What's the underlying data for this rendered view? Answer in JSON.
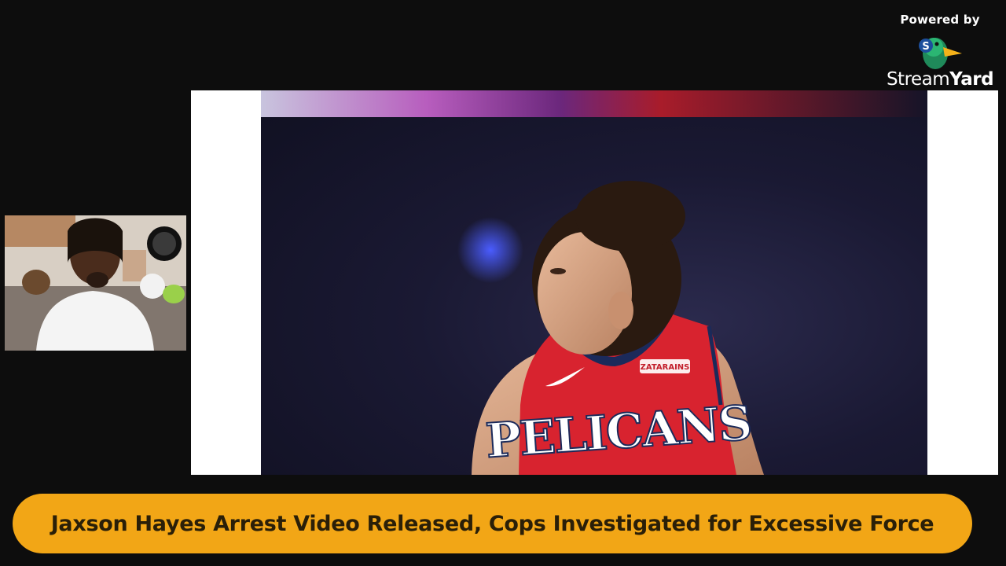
{
  "branding": {
    "powered_by": "Powered by",
    "logo_text_regular": "Stream",
    "logo_text_bold": "Yard",
    "logo_icon": "duck-icon",
    "logo_badge": "S"
  },
  "screen_share": {
    "jersey_text": "PELICANS",
    "patch_text": "ZATARAINS"
  },
  "webcam": {
    "participant": "host-webcam"
  },
  "banner": {
    "headline": "Jaxson Hayes Arrest Video Released, Cops Investigated for Excessive Force"
  },
  "colors": {
    "background": "#0d0d0d",
    "banner": "#f2a616",
    "banner_text": "#2a1f08",
    "jersey_red": "#d8232f",
    "jersey_navy": "#1b2a5a"
  }
}
